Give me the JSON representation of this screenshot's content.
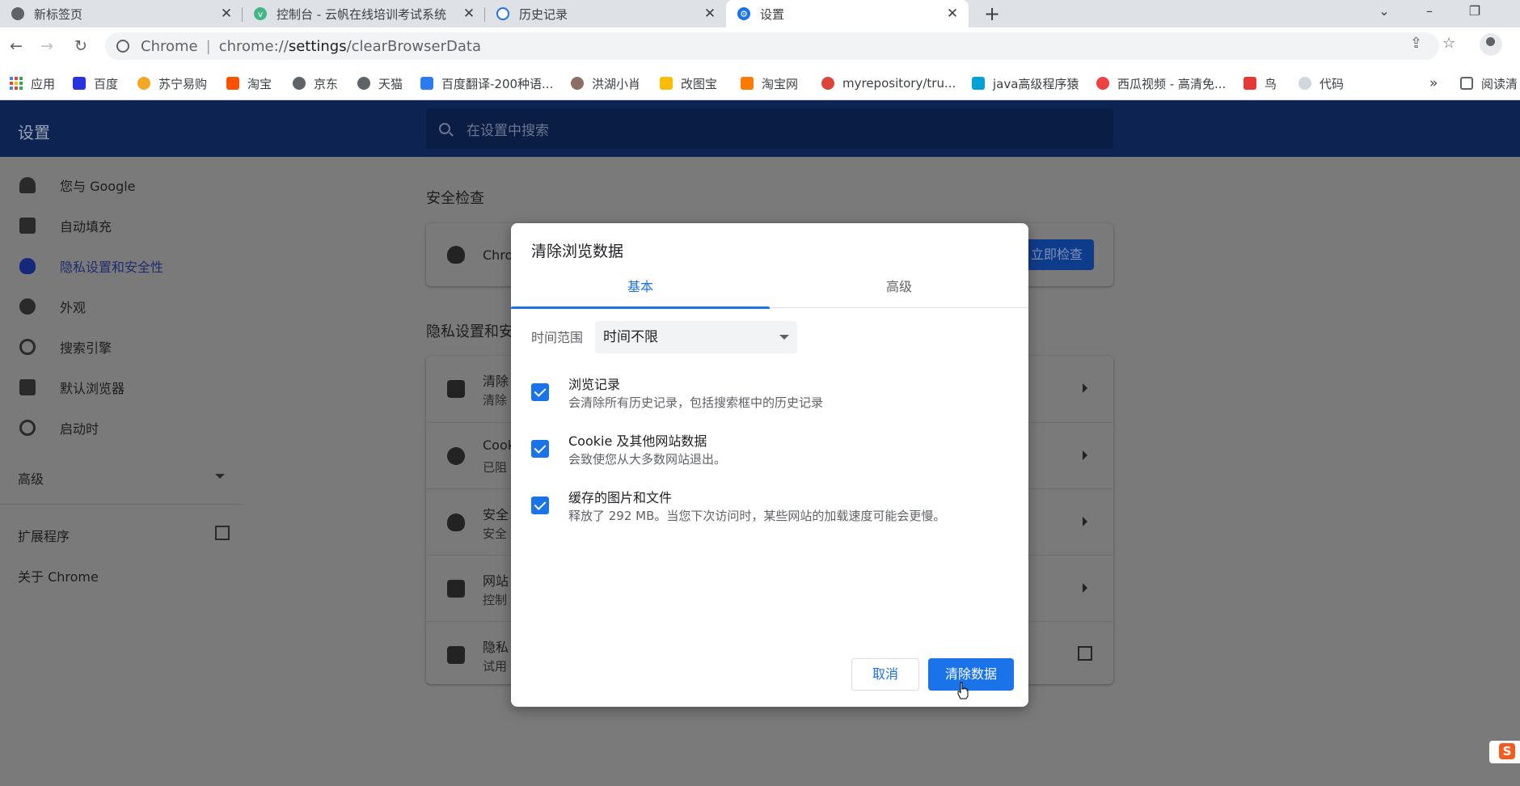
{
  "tabs": [
    {
      "title": "新标签页",
      "icon": "chrome-icon"
    },
    {
      "title": "控制台 - 云帆在线培训考试系统",
      "icon": "vue-icon"
    },
    {
      "title": "历史记录",
      "icon": "history-icon"
    },
    {
      "title": "设置",
      "icon": "gear-icon"
    }
  ],
  "omnibox": {
    "scheme": "Chrome",
    "separator": "|",
    "url_prefix": "chrome://",
    "url_host": "settings",
    "url_path": "/clearBrowserData"
  },
  "bookmarks": [
    "应用",
    "百度",
    "苏宁易购",
    "淘宝",
    "京东",
    "天猫",
    "百度翻译-200种语...",
    "洪湖小肖",
    "改图宝",
    "淘宝网",
    "myrepository/tru...",
    "java高级程序猿",
    "西瓜视频 - 高清免...",
    "鸟",
    "代码",
    "»",
    "阅读清"
  ],
  "settings": {
    "title": "设置",
    "search_placeholder": "在设置中搜索",
    "nav": [
      "您与 Google",
      "自动填充",
      "隐私设置和安全性",
      "外观",
      "搜索引擎",
      "默认浏览器",
      "启动时"
    ],
    "advanced": "高级",
    "extensions": "扩展程序",
    "about": "关于 Chrome",
    "safety_check_heading": "安全检查",
    "safety_check_text": "Chro",
    "safety_check_button": "立即检查",
    "privacy_heading": "隐私设置和安",
    "privacy_rows": [
      {
        "title": "清除",
        "sub": "清除"
      },
      {
        "title": "Cook",
        "sub": "已阻"
      },
      {
        "title": "安全",
        "sub": "安全"
      },
      {
        "title": "网站",
        "sub": "控制"
      },
      {
        "title": "隐私",
        "sub": "试用"
      }
    ]
  },
  "dialog": {
    "title": "清除浏览数据",
    "tab_basic": "基本",
    "tab_advanced": "高级",
    "time_range_label": "时间范围",
    "time_range_value": "时间不限",
    "options": [
      {
        "title": "浏览记录",
        "sub": "会清除所有历史记录，包括搜索框中的历史记录",
        "checked": true
      },
      {
        "title": "Cookie 及其他网站数据",
        "sub": "会致使您从大多数网站退出。",
        "checked": true
      },
      {
        "title": "缓存的图片和文件",
        "sub": "释放了 292 MB。当您下次访问时，某些网站的加载速度可能会更慢。",
        "checked": true
      }
    ],
    "cancel": "取消",
    "clear": "清除数据"
  },
  "colors": {
    "accent": "#1a73e8",
    "header": "#0d2452"
  }
}
